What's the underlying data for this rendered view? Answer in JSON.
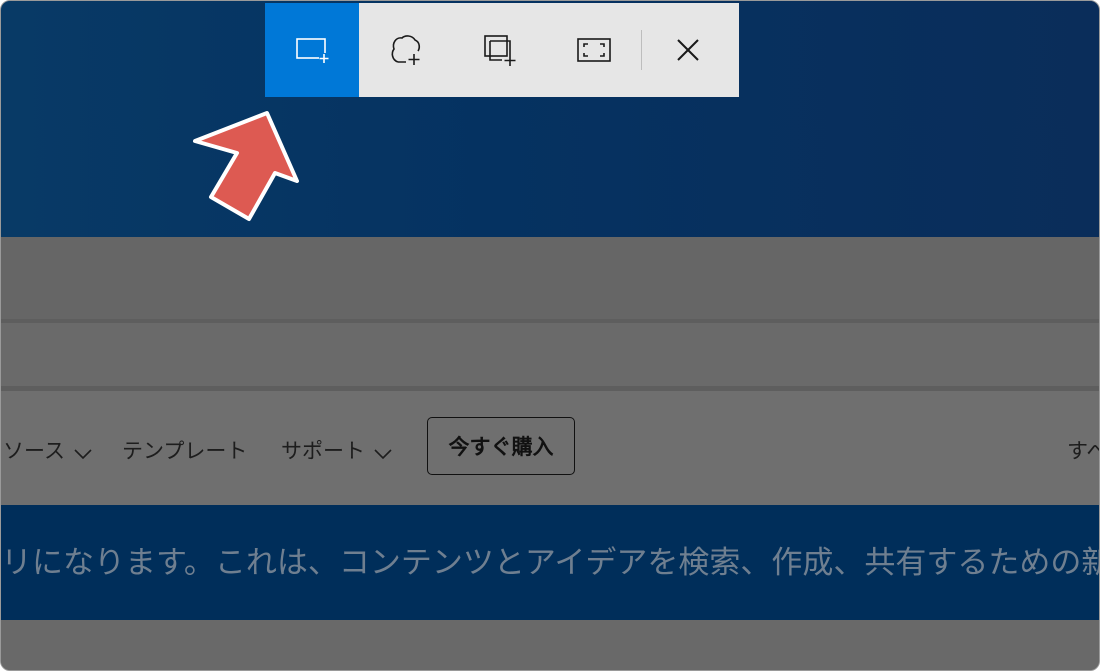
{
  "snip_toolbar": {
    "tools": [
      {
        "id": "rectangular",
        "icon": "rectangle-snip-icon",
        "active": true
      },
      {
        "id": "freeform",
        "icon": "freeform-snip-icon",
        "active": false
      },
      {
        "id": "window",
        "icon": "window-snip-icon",
        "active": false
      },
      {
        "id": "fullscreen",
        "icon": "fullscreen-snip-icon",
        "active": false
      }
    ],
    "close_icon": "close-icon",
    "active_color": "#0078d7"
  },
  "annotation": {
    "icon": "pointer-arrow-icon",
    "color": "#e05a52"
  },
  "nav": {
    "items": [
      {
        "label": "ソース",
        "has_dropdown": true
      },
      {
        "label": "テンプレート",
        "has_dropdown": false
      },
      {
        "label": "サポート",
        "has_dropdown": true
      }
    ],
    "buy_button": "今すぐ購入",
    "right_fragment": "すべ"
  },
  "banner": {
    "text": "リになります。これは、コンテンツとアイデアを検索、作成、共有するための新"
  }
}
